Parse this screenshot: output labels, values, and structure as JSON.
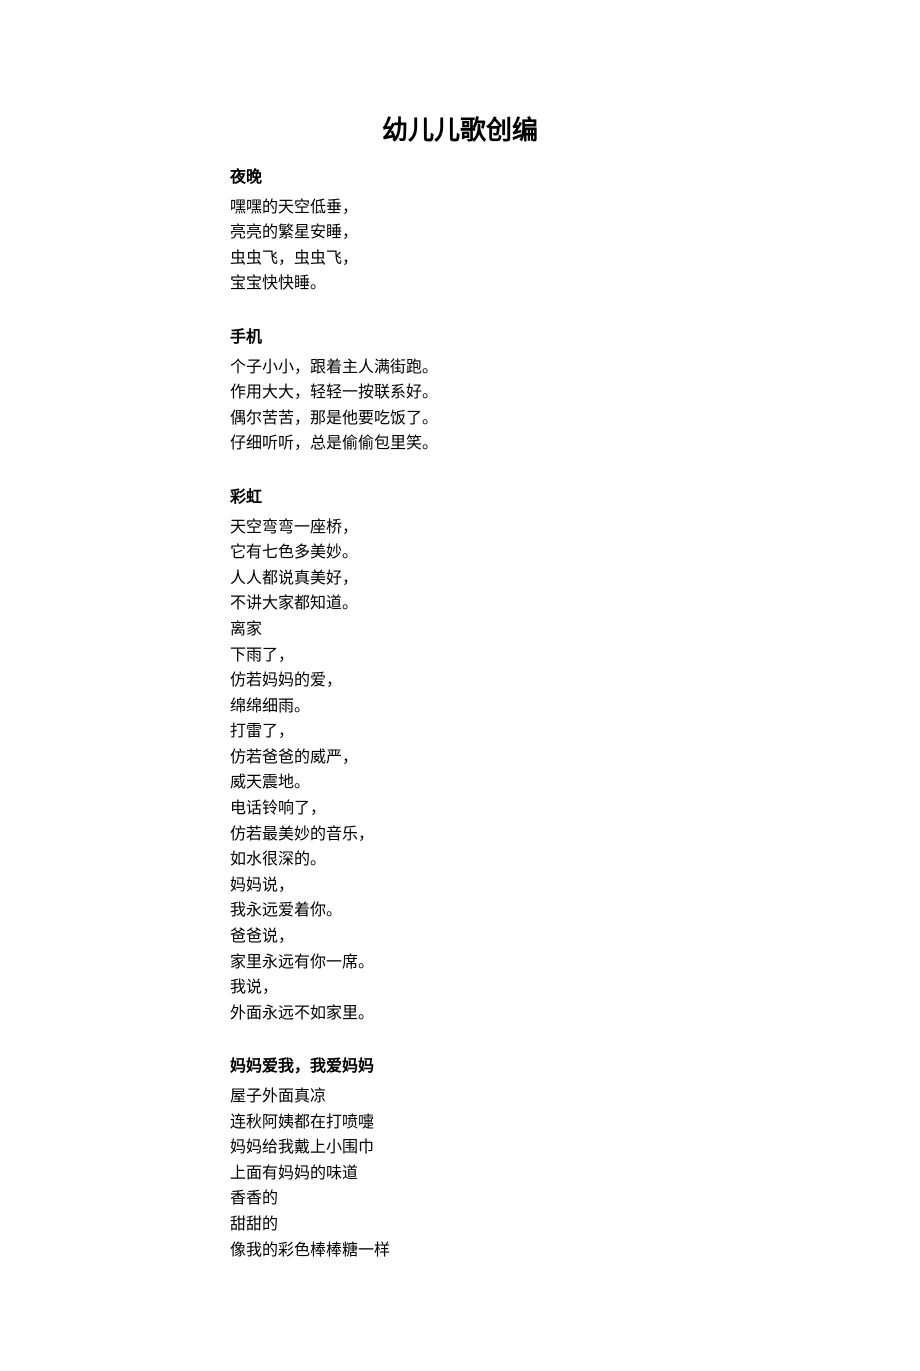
{
  "title": "幼儿儿歌创编",
  "sections": [
    {
      "heading": "夜晚",
      "lines": [
        "嘿嘿的天空低垂，",
        "亮亮的繁星安睡，",
        "虫虫飞，虫虫飞，",
        "宝宝快快睡。"
      ]
    },
    {
      "heading": "手机",
      "lines": [
        "个子小小，跟着主人满街跑。",
        "作用大大，轻轻一按联系好。",
        "偶尔苦苦，那是他要吃饭了。",
        "仔细听听，总是偷偷包里笑。"
      ]
    },
    {
      "heading": "彩虹",
      "lines": [
        "天空弯弯一座桥，",
        "它有七色多美妙。",
        "人人都说真美好，",
        "不讲大家都知道。",
        "离家",
        "下雨了，",
        "仿若妈妈的爱，",
        "绵绵细雨。",
        "打雷了，",
        "仿若爸爸的威严，",
        "威天震地。",
        "电话铃响了，",
        "仿若最美妙的音乐，",
        "如水很深的。",
        "妈妈说，",
        "我永远爱着你。",
        "爸爸说，",
        "家里永远有你一席。",
        "我说，",
        "外面永远不如家里。"
      ]
    },
    {
      "heading": "妈妈爱我，我爱妈妈",
      "lines": [
        "屋子外面真凉",
        "连秋阿姨都在打喷嚏",
        "妈妈给我戴上小围巾",
        "上面有妈妈的味道",
        "香香的",
        "甜甜的",
        "像我的彩色棒棒糖一样"
      ]
    }
  ]
}
